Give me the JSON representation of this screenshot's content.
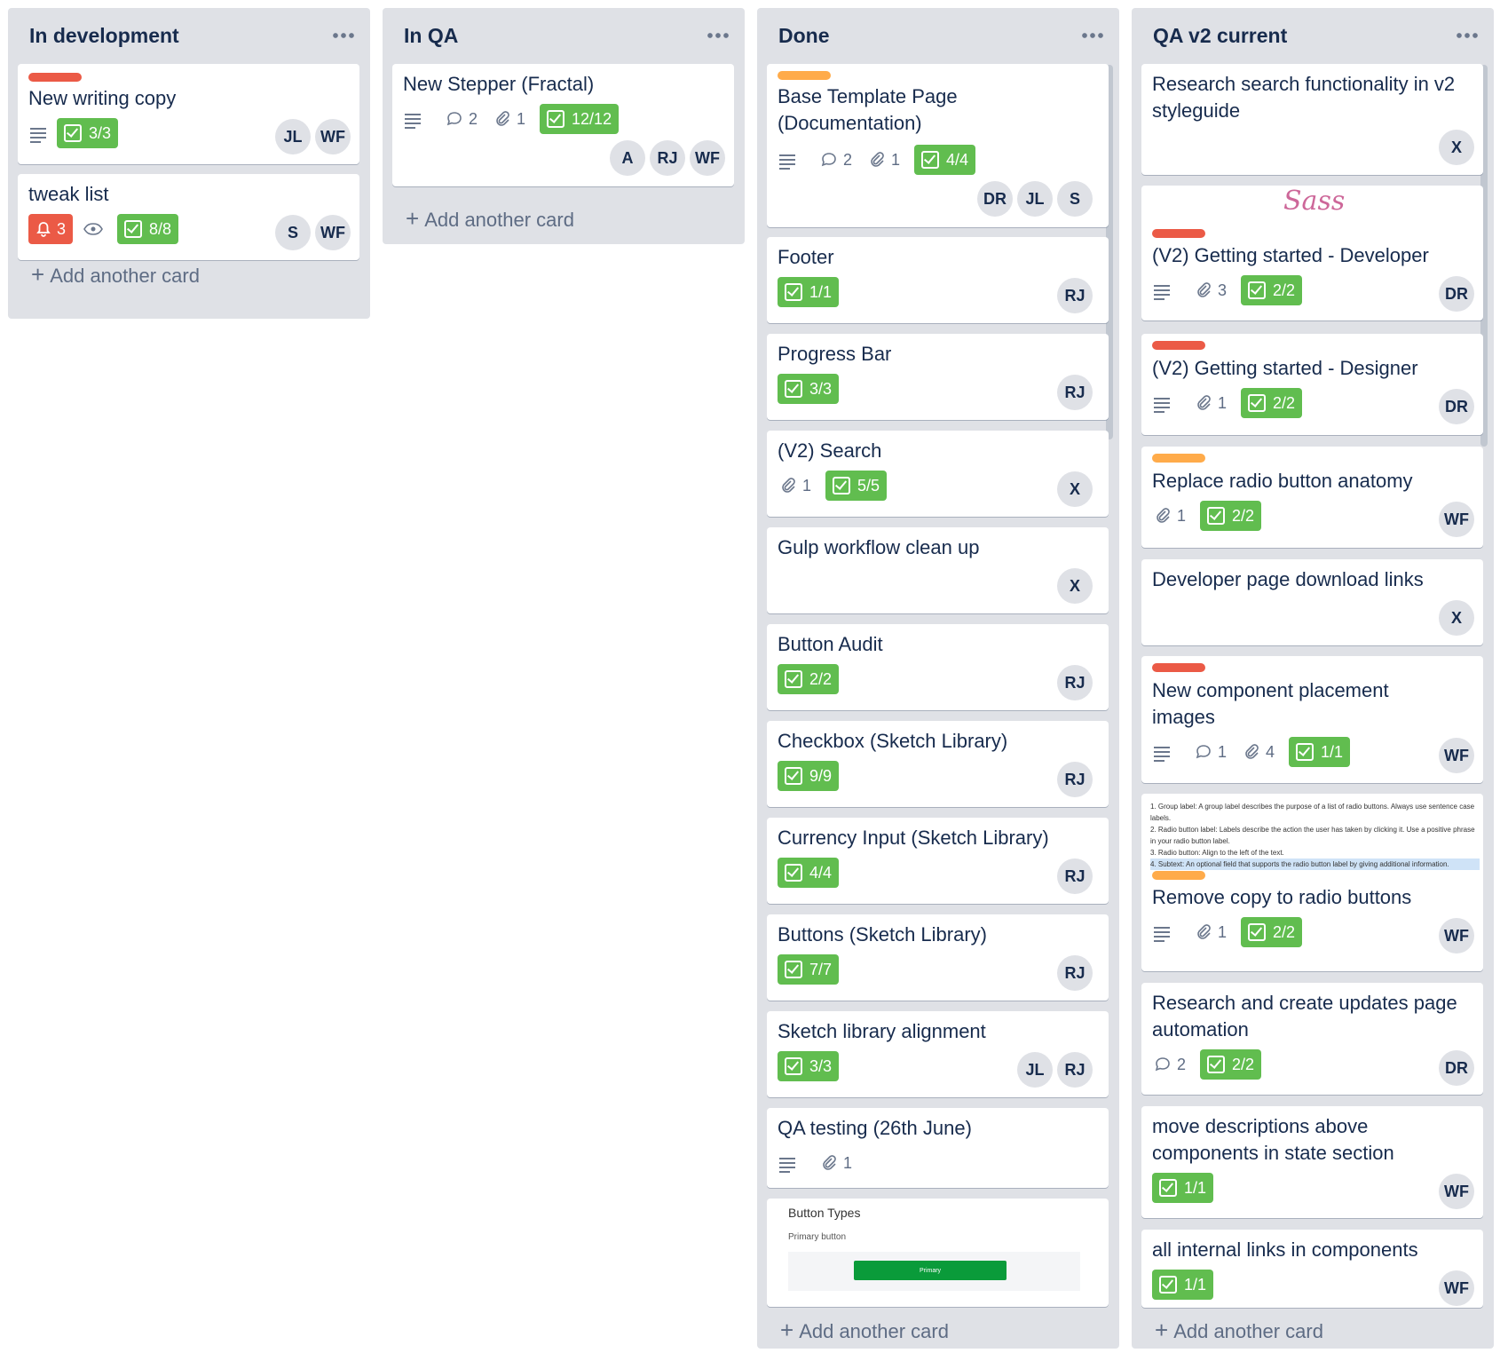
{
  "lists": [
    {
      "title": "In development",
      "add_card": "Add another card",
      "cards": [
        {
          "title": "New writing copy",
          "checklist": "3/3",
          "members": [
            "JL",
            "WF"
          ]
        },
        {
          "title": "tweak list",
          "due": "3",
          "checklist": "8/8",
          "members": [
            "S",
            "WF"
          ]
        }
      ]
    },
    {
      "title": "In QA",
      "add_card": "Add another card",
      "cards": [
        {
          "title": "New Stepper (Fractal)",
          "comments": "2",
          "attachments": "1",
          "checklist": "12/12",
          "members": [
            "A",
            "RJ",
            "WF"
          ]
        }
      ]
    },
    {
      "title": "Done",
      "add_card": "Add another card",
      "cards": [
        {
          "title": "Base Template Page (Documentation)",
          "comments": "2",
          "attachments": "1",
          "checklist": "4/4",
          "members": [
            "DR",
            "JL",
            "S"
          ]
        },
        {
          "title": "Footer",
          "checklist": "1/1",
          "members": [
            "RJ"
          ]
        },
        {
          "title": "Progress Bar",
          "checklist": "3/3",
          "members": [
            "RJ"
          ]
        },
        {
          "title": "(V2) Search",
          "attachments": "1",
          "checklist": "5/5",
          "members": [
            "X"
          ]
        },
        {
          "title": "Gulp workflow clean up",
          "members": [
            "X"
          ]
        },
        {
          "title": "Button Audit",
          "checklist": "2/2",
          "members": [
            "RJ"
          ]
        },
        {
          "title": "Checkbox (Sketch Library)",
          "checklist": "9/9",
          "members": [
            "RJ"
          ]
        },
        {
          "title": "Currency Input (Sketch Library)",
          "checklist": "4/4",
          "members": [
            "RJ"
          ]
        },
        {
          "title": "Buttons (Sketch Library)",
          "checklist": "7/7",
          "members": [
            "RJ"
          ]
        },
        {
          "title": "Sketch library alignment",
          "checklist": "3/3",
          "members": [
            "JL",
            "RJ"
          ]
        },
        {
          "title": "QA testing (26th June)",
          "attachments": "1"
        },
        {
          "preview_title": "Button Types",
          "preview_sub": "Primary button",
          "preview_btn": "Primary"
        }
      ]
    },
    {
      "title": "QA v2 current",
      "add_card": "Add another card",
      "cards": [
        {
          "title": "Research search functionality in v2 styleguide",
          "members": [
            "X"
          ]
        },
        {
          "cover": "Sass",
          "title": "(V2) Getting started - Developer",
          "attachments": "3",
          "checklist": "2/2",
          "members": [
            "DR"
          ]
        },
        {
          "title": "(V2) Getting started - Designer",
          "attachments": "1",
          "checklist": "2/2",
          "members": [
            "DR"
          ]
        },
        {
          "title": "Replace radio button anatomy",
          "attachments": "1",
          "checklist": "2/2",
          "members": [
            "WF"
          ]
        },
        {
          "title": "Developer page download links",
          "members": [
            "X"
          ]
        },
        {
          "title": "New component placement images",
          "comments": "1",
          "attachments": "4",
          "checklist": "1/1",
          "members": [
            "WF"
          ]
        },
        {
          "cover_lines": [
            "1.  Group label: A group label describes the purpose of a list of radio buttons. Always use sentence case labels.",
            "2.  Radio button label: Labels describe the action the user has taken by clicking it. Use a positive phrase in your radio button label.",
            "3.  Radio button: Align to the left of the text.",
            "4.  Subtext: An optional field that supports the radio button label by giving additional information."
          ],
          "title": "Remove copy to radio buttons",
          "attachments": "1",
          "checklist": "2/2",
          "members": [
            "WF"
          ]
        },
        {
          "title": "Research and create updates page automation",
          "comments": "2",
          "checklist": "2/2",
          "members": [
            "DR"
          ]
        },
        {
          "title": "move descriptions above components in state section",
          "checklist": "1/1",
          "members": [
            "WF"
          ]
        },
        {
          "title": "all internal links in components",
          "checklist": "1/1",
          "members": [
            "WF"
          ]
        }
      ]
    }
  ],
  "colors": {
    "label_red": "#eb5a46",
    "label_orange": "#ffab4a",
    "checklist_green": "#61bd4f",
    "list_bg": "#dfe1e6"
  }
}
